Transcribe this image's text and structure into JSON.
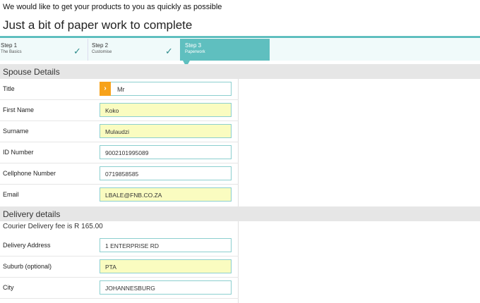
{
  "intro": "We would like to get your products to you as quickly as possible",
  "heading": "Just a bit of paper work to complete",
  "steps": [
    {
      "title": "Step 1",
      "subtitle": "The Basics",
      "check": "✓"
    },
    {
      "title": "Step 2",
      "subtitle": "Customise",
      "check": "✓"
    },
    {
      "title": "Step 3",
      "subtitle": "Paperwork"
    }
  ],
  "spouse": {
    "header": "Spouse Details",
    "title_label": "Title",
    "title_value": "Mr",
    "title_button_glyph": "›",
    "first_name_label": "First Name",
    "first_name_value": "Koko",
    "surname_label": "Surname",
    "surname_value": "Mulaudzi",
    "id_label": "ID Number",
    "id_value": "9002101995089",
    "cell_label": "Cellphone Number",
    "cell_value": "0719858585",
    "email_label": "Email",
    "email_value": "LBALE@FNB.CO.ZA"
  },
  "delivery": {
    "header": "Delivery details",
    "courier_fee": "Courier Delivery fee is R 165.00",
    "address_label": "Delivery Address",
    "address_value": "1 ENTERPRISE RD",
    "suburb_label": "Suburb (optional)",
    "suburb_value": "PTA",
    "city_label": "City",
    "city_value": "JOHANNESBURG"
  },
  "colors": {
    "accent": "#5fbfbf",
    "button": "#f7a21a",
    "highlight": "#fafcc0"
  }
}
